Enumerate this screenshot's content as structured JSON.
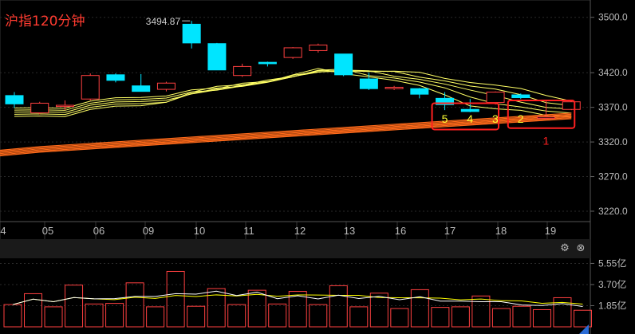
{
  "title": "沪指120分钟",
  "buttons": {
    "settings_icon": "gear-icon",
    "close_icon": "close-icon"
  },
  "colors": {
    "up": "#ff4040",
    "down": "#00e5ff",
    "ma_yellow": "#ffff66",
    "ma_orange": "#ff6a1a",
    "vol_ma1": "#ffffff",
    "vol_ma2": "#ffff00",
    "box": "#ff2020"
  },
  "chart_data": [
    {
      "type": "candlestick",
      "x_labels": [
        "4",
        "05",
        "06",
        "09",
        "10",
        "11",
        "12",
        "13",
        "16",
        "17",
        "18",
        "19"
      ],
      "y_ticks": [
        "3500.0",
        "3420.0",
        "3370.0",
        "3320.0",
        "3270.0",
        "3220.0"
      ],
      "ylim": [
        3205,
        3525
      ],
      "grid": true,
      "candles": [
        {
          "o": 3387,
          "c": 3375,
          "h": 3392,
          "l": 3369
        },
        {
          "o": 3362,
          "c": 3376,
          "h": 3378,
          "l": 3360
        },
        {
          "o": 3373,
          "c": 3373,
          "h": 3380,
          "l": 3366
        },
        {
          "o": 3382,
          "c": 3416,
          "h": 3419,
          "l": 3380
        },
        {
          "o": 3417,
          "c": 3409,
          "h": 3419,
          "l": 3406
        },
        {
          "o": 3401,
          "c": 3393,
          "h": 3418,
          "l": 3393
        },
        {
          "o": 3396,
          "c": 3405,
          "h": 3407,
          "l": 3393
        },
        {
          "o": 3490,
          "c": 3463,
          "h": 3494.87,
          "l": 3455
        },
        {
          "o": 3462,
          "c": 3424,
          "h": 3463,
          "l": 3424
        },
        {
          "o": 3416,
          "c": 3429,
          "h": 3433,
          "l": 3414
        },
        {
          "o": 3435,
          "c": 3433,
          "h": 3436,
          "l": 3429
        },
        {
          "o": 3442,
          "c": 3456,
          "h": 3457,
          "l": 3440
        },
        {
          "o": 3452,
          "c": 3460,
          "h": 3462,
          "l": 3449
        },
        {
          "o": 3447,
          "c": 3417,
          "h": 3447,
          "l": 3415
        },
        {
          "o": 3411,
          "c": 3397,
          "h": 3420,
          "l": 3395
        },
        {
          "o": 3397,
          "c": 3399,
          "h": 3401,
          "l": 3395
        },
        {
          "o": 3397,
          "c": 3389,
          "h": 3398,
          "l": 3383
        },
        {
          "o": 3383,
          "c": 3374,
          "h": 3392,
          "l": 3366
        },
        {
          "o": 3367,
          "c": 3364,
          "h": 3382,
          "l": 3363
        },
        {
          "o": 3377,
          "c": 3392,
          "h": 3393,
          "l": 3374
        },
        {
          "o": 3388,
          "c": 3384,
          "h": 3390,
          "l": 3382
        },
        {
          "o": 3354,
          "c": 3356,
          "h": 3380,
          "l": 3353
        },
        {
          "o": 3367,
          "c": 3378,
          "h": 3380,
          "l": 3366
        }
      ],
      "annotations": [
        {
          "text": "3494.87",
          "candle": 7
        },
        {
          "text": "5",
          "candle": 17
        },
        {
          "text": "4",
          "candle": 18
        },
        {
          "text": "3",
          "candle": 19
        },
        {
          "text": "2",
          "candle": 20
        },
        {
          "text": "1",
          "candle": 21
        }
      ],
      "boxes": [
        {
          "candle_from": 17,
          "candle_to": 19,
          "y_from": 3338,
          "y_to": 3376
        },
        {
          "candle_from": 20,
          "candle_to": 22,
          "y_from": 3340,
          "y_to": 3380
        }
      ]
    },
    {
      "type": "bar",
      "y_ticks": [
        "5.55亿",
        "3.70亿",
        "1.85亿"
      ],
      "ylim": [
        0,
        6.0
      ],
      "values": [
        1.95,
        2.9,
        1.75,
        3.65,
        2.0,
        2.05,
        3.85,
        1.75,
        4.85,
        1.8,
        3.35,
        1.95,
        3.2,
        2.0,
        3.1,
        1.95,
        3.6,
        1.75,
        2.95,
        1.6,
        3.25,
        1.7,
        1.75,
        2.7,
        1.6,
        1.8,
        1.5,
        2.55,
        1.45
      ]
    }
  ]
}
